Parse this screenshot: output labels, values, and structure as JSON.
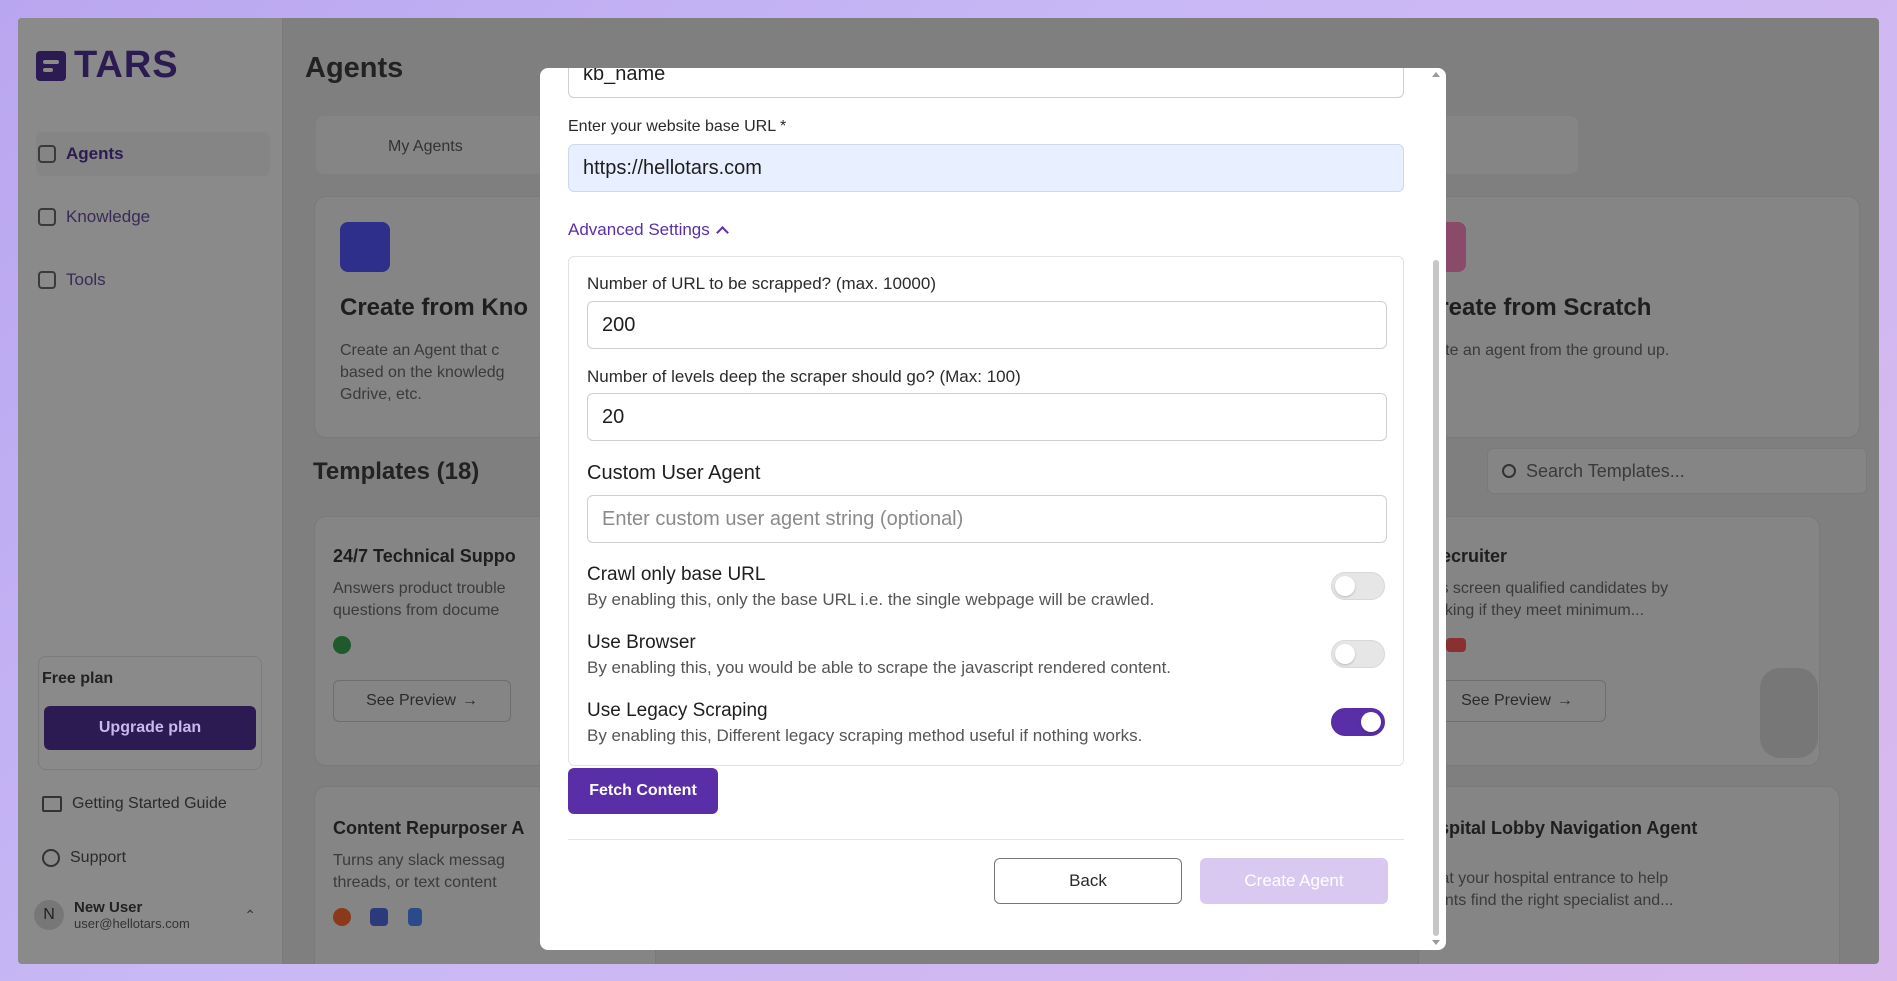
{
  "app": {
    "logo_text": "TARS",
    "page_title": "Agents"
  },
  "sidebar": {
    "items": [
      {
        "label": "Agents",
        "icon": "robot-icon"
      },
      {
        "label": "Knowledge",
        "icon": "book-icon"
      },
      {
        "label": "Tools",
        "icon": "wrench-icon"
      }
    ],
    "plan_label": "Free plan",
    "upgrade_label": "Upgrade plan",
    "getting_started": "Getting Started Guide",
    "support": "Support",
    "user": {
      "initial": "N",
      "name": "New User",
      "email": "user@hellotars.com"
    }
  },
  "background": {
    "tab_label": "My Agents",
    "card_left": {
      "title": "Create from Kno",
      "text": [
        "Create an Agent that c",
        "based on the knowledg",
        "Gdrive, etc."
      ]
    },
    "card_right": {
      "title": "Create from Scratch",
      "text": "reate an agent from the ground up."
    },
    "templates_title": "Templates (18)",
    "search_placeholder": "Search Templates...",
    "template_1": {
      "title": "24/7 Technical Suppo",
      "text": [
        "Answers product trouble",
        "questions from docume"
      ],
      "preview": "See Preview"
    },
    "template_2": {
      "title": "Recruiter",
      "text": [
        "lps screen qualified candidates by",
        "ecking if they meet minimum..."
      ],
      "preview": "See Preview"
    },
    "template_3": {
      "title": "Content Repurposer A",
      "text": [
        "Turns any slack messag",
        "threads, or text content"
      ]
    },
    "template_4": {
      "title": "ospital Lobby Navigation Agent",
      "text": [
        "s at your hospital entrance to help",
        "tients find the right specialist and..."
      ]
    }
  },
  "modal": {
    "kb_name_value": "kb_name",
    "url_label": "Enter your website base URL *",
    "url_value": "https://hellotars.com",
    "advanced_label": "Advanced Settings",
    "num_urls_label": "Number of URL to be scrapped? (max. 10000)",
    "num_urls_value": "200",
    "levels_label": "Number of levels deep the scraper should go? (Max: 100)",
    "levels_value": "20",
    "custom_ua_title": "Custom User Agent",
    "custom_ua_placeholder": "Enter custom user agent string (optional)",
    "options": [
      {
        "title": "Crawl only base URL",
        "desc": "By enabling this, only the base URL i.e. the single webpage will be crawled.",
        "enabled": false
      },
      {
        "title": "Use Browser",
        "desc": "By enabling this, you would be able to scrape the javascript rendered content.",
        "enabled": false
      },
      {
        "title": "Use Legacy Scraping",
        "desc": "By enabling this, Different legacy scraping method useful if nothing works.",
        "enabled": true
      }
    ],
    "fetch_label": "Fetch Content",
    "back_label": "Back",
    "create_label": "Create Agent"
  },
  "colors": {
    "accent": "#5a2ea6",
    "accent_disabled": "#d9c9f0",
    "url_field_bg": "#e8effe"
  }
}
